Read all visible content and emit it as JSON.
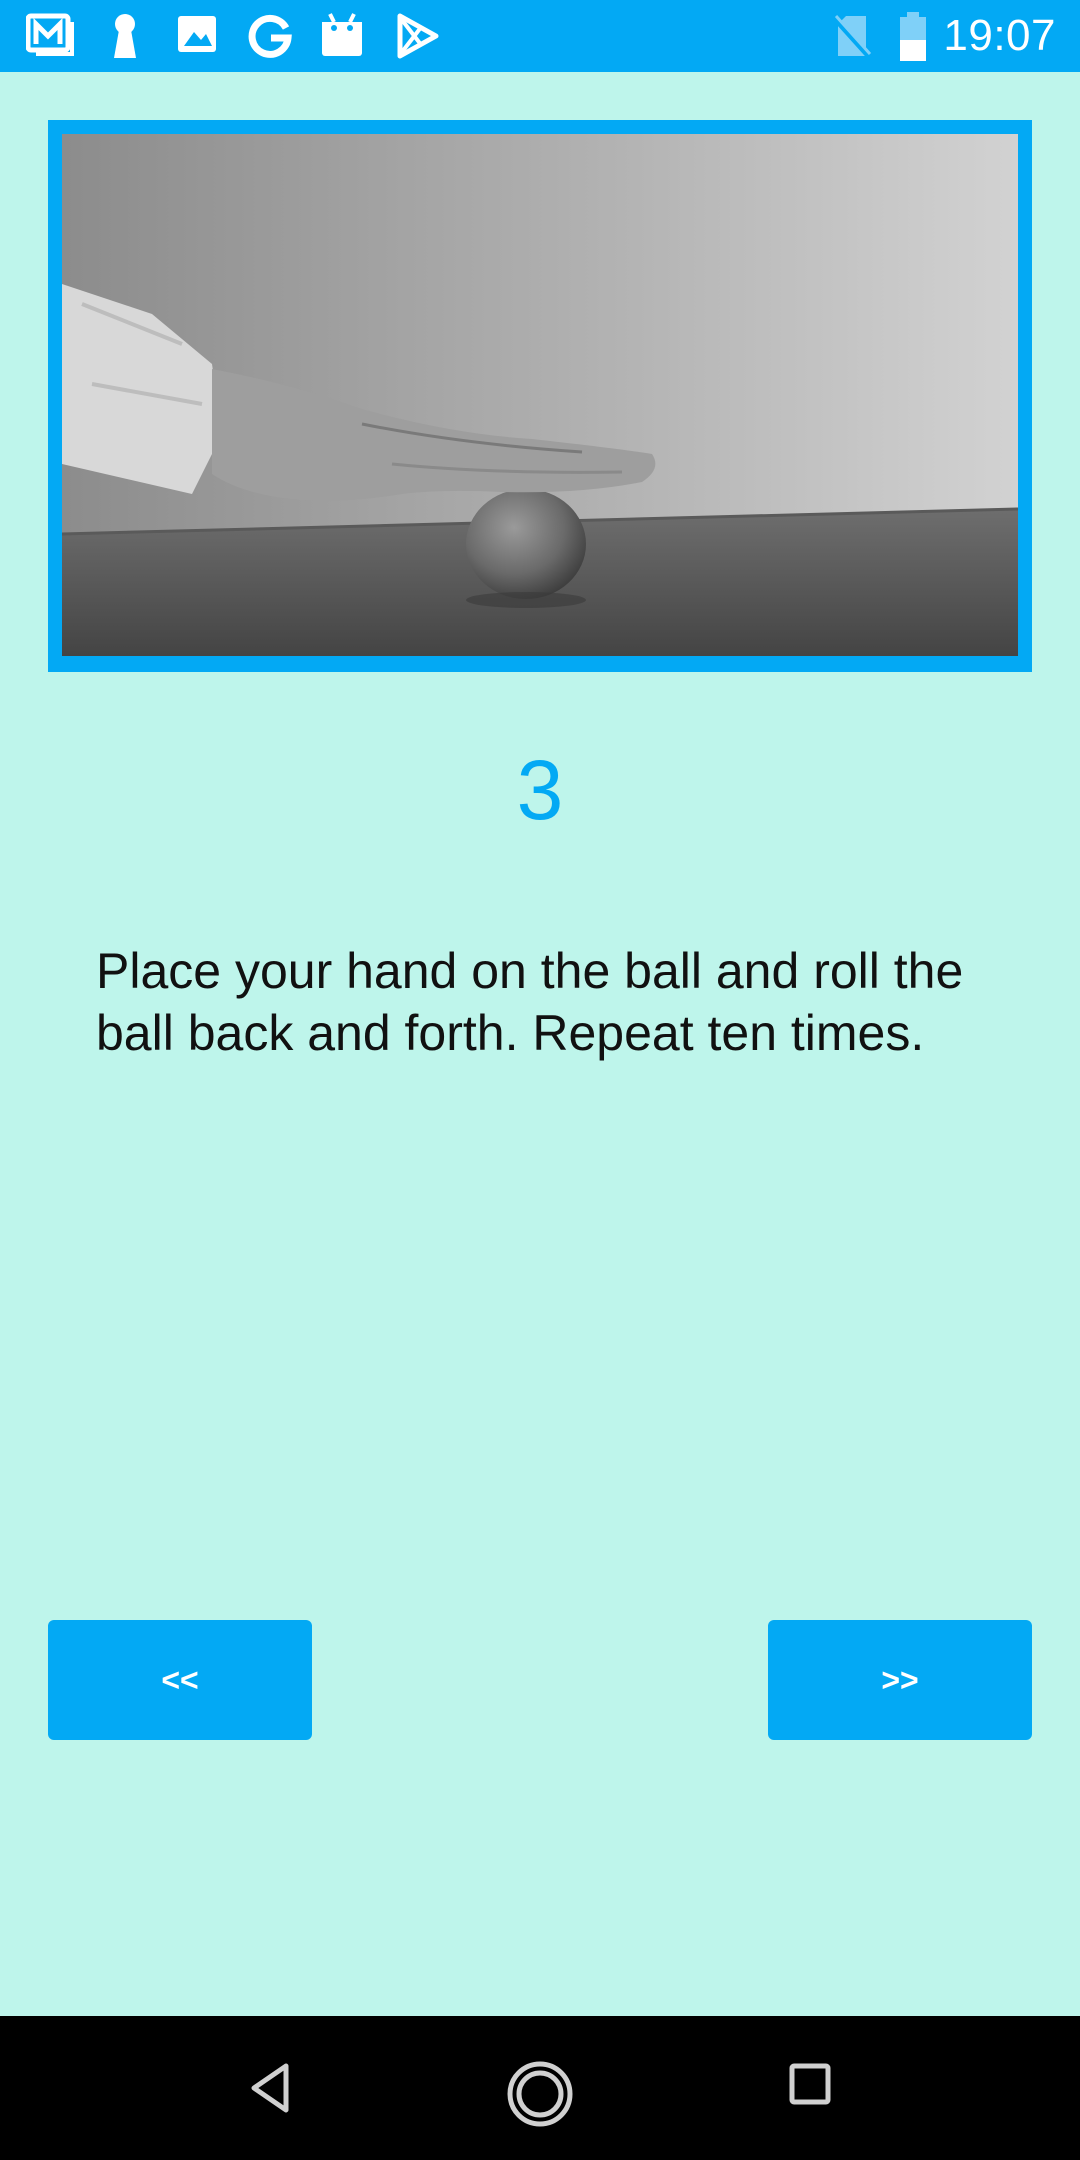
{
  "status_bar": {
    "time": "19:07",
    "icons": [
      "gmail-icon",
      "keyhole-icon",
      "image-icon",
      "google-icon",
      "calendar-app-icon",
      "play-store-icon",
      "no-sim-icon",
      "battery-icon"
    ]
  },
  "colors": {
    "accent": "#03a9f4",
    "background": "#bef5eb",
    "nav_bar": "#000000"
  },
  "exercise": {
    "image_description": "hand rolling ball on table",
    "step_number": "3",
    "instruction": "Place your hand on the ball and roll the ball back and forth. Repeat ten times."
  },
  "navigation": {
    "prev_label": "<<",
    "next_label": ">>"
  },
  "system_nav": {
    "icons": [
      "back-icon",
      "home-icon",
      "recents-icon"
    ]
  }
}
